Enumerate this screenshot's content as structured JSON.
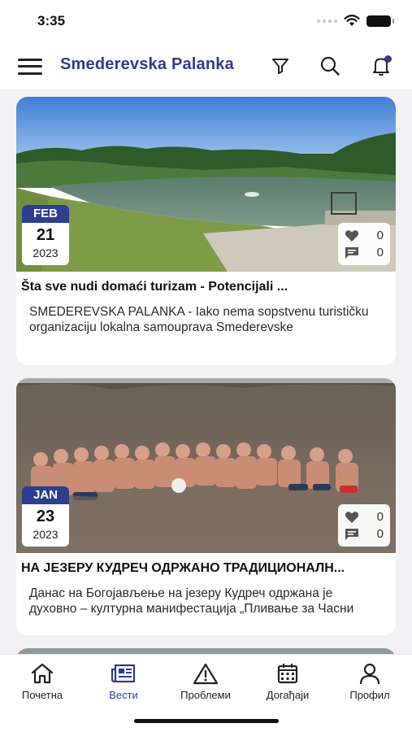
{
  "status_bar": {
    "time": "3:35"
  },
  "header": {
    "title": "Smederevska Palanka",
    "has_notification": true
  },
  "posts": [
    {
      "month": "FEB",
      "day": "21",
      "year": "2023",
      "likes": "0",
      "comments": "0",
      "title": "Šta sve nudi domaći turizam - Potencijali ...",
      "excerpt": "SMEDEREVSKA PALANKA - Iako nema sopstvenu turističku organizaciju lokalna samouprava Smederevske",
      "image_icon": "lake-landscape-photo"
    },
    {
      "month": "JAN",
      "day": "23",
      "year": "2023",
      "likes": "0",
      "comments": "0",
      "title": "НА ЈЕЗЕРУ КУДРЕЧ ОДРЖАНО ТРАДИЦИОНАЛН...",
      "excerpt": "Данас на Богојављење на језеру Кудреч одржана је духовно – културна манифестација „Пливање за Часни",
      "image_icon": "people-in-lake-photo"
    }
  ],
  "nav": {
    "items": [
      {
        "label": "Почетна",
        "icon": "home-icon",
        "active": false
      },
      {
        "label": "Вести",
        "icon": "news-icon",
        "active": true
      },
      {
        "label": "Проблеми",
        "icon": "warning-icon",
        "active": false
      },
      {
        "label": "Догађаји",
        "icon": "calendar-icon",
        "active": false
      },
      {
        "label": "Профил",
        "icon": "user-icon",
        "active": false
      }
    ]
  },
  "colors": {
    "brand": "#2c3e8f",
    "background": "#f2f2f4"
  }
}
